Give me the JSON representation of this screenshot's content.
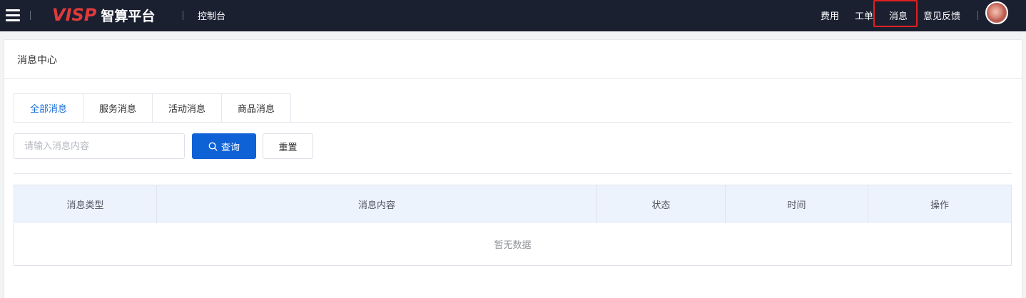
{
  "header": {
    "logo_mark": "VISP",
    "logo_text": "智算平台",
    "console_label": "控制台",
    "nav": {
      "fees": "费用",
      "tickets": "工单",
      "messages": "消息",
      "feedback": "意见反馈"
    },
    "colors": {
      "background": "#1b2031",
      "logo_red": "#e03a3a",
      "highlight": "#e02020"
    }
  },
  "page": {
    "title": "消息中心"
  },
  "tabs": [
    {
      "label": "全部消息",
      "active": true
    },
    {
      "label": "服务消息",
      "active": false
    },
    {
      "label": "活动消息",
      "active": false
    },
    {
      "label": "商品消息",
      "active": false
    }
  ],
  "search": {
    "placeholder": "请输入消息内容",
    "value": "",
    "query_label": "查询",
    "reset_label": "重置"
  },
  "table": {
    "columns": [
      "消息类型",
      "消息内容",
      "状态",
      "时间",
      "操作"
    ],
    "rows": [],
    "empty_text": "暂无数据"
  },
  "colors": {
    "primary": "#0f62d6",
    "table_header_bg": "#edf3fd"
  }
}
